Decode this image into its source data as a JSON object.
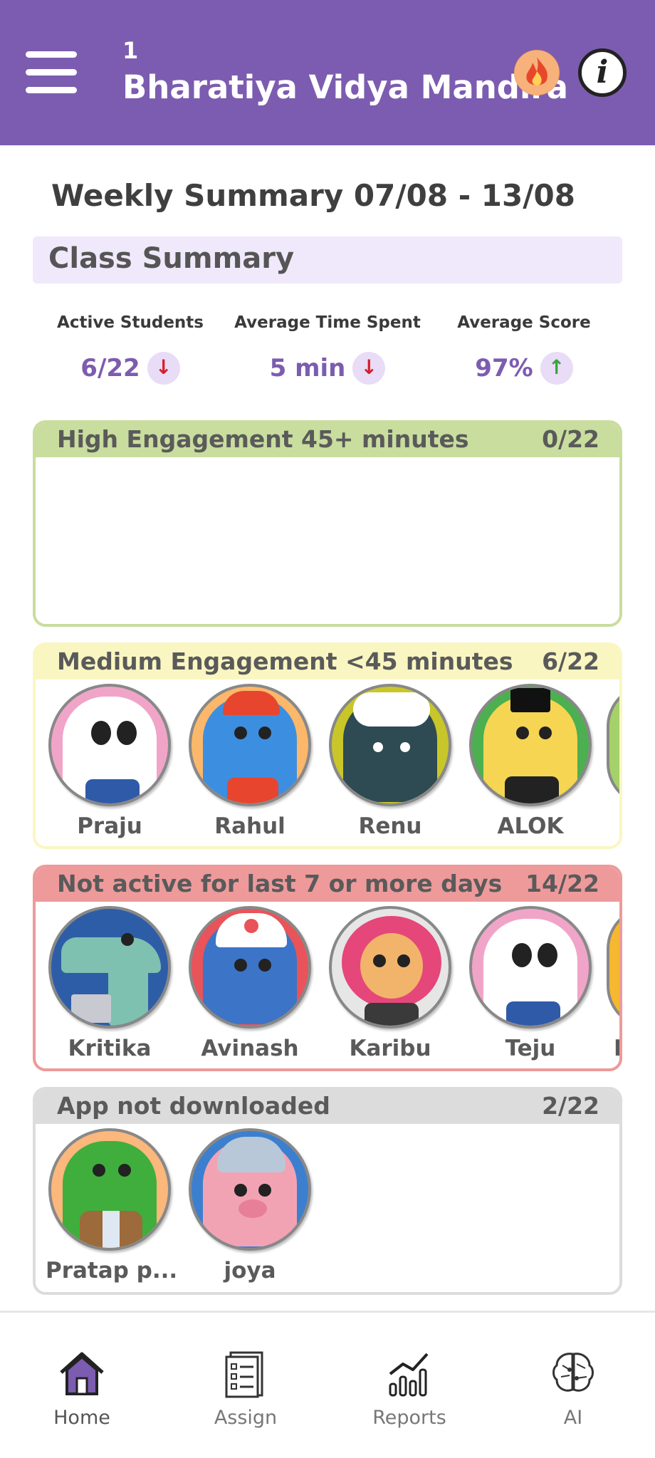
{
  "header": {
    "class_number": "1",
    "school_name": "Bharatiya Vidya Mandira",
    "menu_icon": "hamburger-menu-icon",
    "streak_icon": "fire-icon",
    "info_icon": "info-icon",
    "info_glyph": "i"
  },
  "summary": {
    "title": "Weekly Summary 07/08 - 13/08",
    "class_summary_label": "Class Summary",
    "stats": [
      {
        "label": "Active Students",
        "value": "6/22",
        "trend": "down"
      },
      {
        "label": "Average Time Spent",
        "value": "5 min",
        "trend": "down"
      },
      {
        "label": "Average Score",
        "value": "97%",
        "trend": "up"
      }
    ],
    "arrow_down": "↓",
    "arrow_up": "↑"
  },
  "groups": [
    {
      "title": "High Engagement 45+ minutes",
      "count": "0/22",
      "color": "#c9dd9e",
      "students": []
    },
    {
      "title": "Medium Engagement <45 minutes",
      "count": "6/22",
      "color": "#faf6c2",
      "students": [
        "Praju",
        "Rahul",
        "Renu",
        "ALOK"
      ]
    },
    {
      "title": "Not active for last 7 or more days",
      "count": "14/22",
      "color": "#ee9a9a",
      "students": [
        "Kritika",
        "Avinash",
        "Karibu",
        "Teju"
      ],
      "partial_label": "K"
    },
    {
      "title": "App not downloaded",
      "count": "2/22",
      "color": "#dcdcdc",
      "students": [
        "Pratap p...",
        "joya"
      ]
    }
  ],
  "nav": [
    {
      "label": "Home",
      "icon": "home-icon",
      "active": true
    },
    {
      "label": "Assign",
      "icon": "assign-icon",
      "active": false
    },
    {
      "label": "Reports",
      "icon": "reports-icon",
      "active": false
    },
    {
      "label": "AI",
      "icon": "ai-brain-icon",
      "active": false
    }
  ],
  "colors": {
    "brand": "#7c5cb0",
    "down": "#d61f2e",
    "up": "#3aa33c"
  }
}
